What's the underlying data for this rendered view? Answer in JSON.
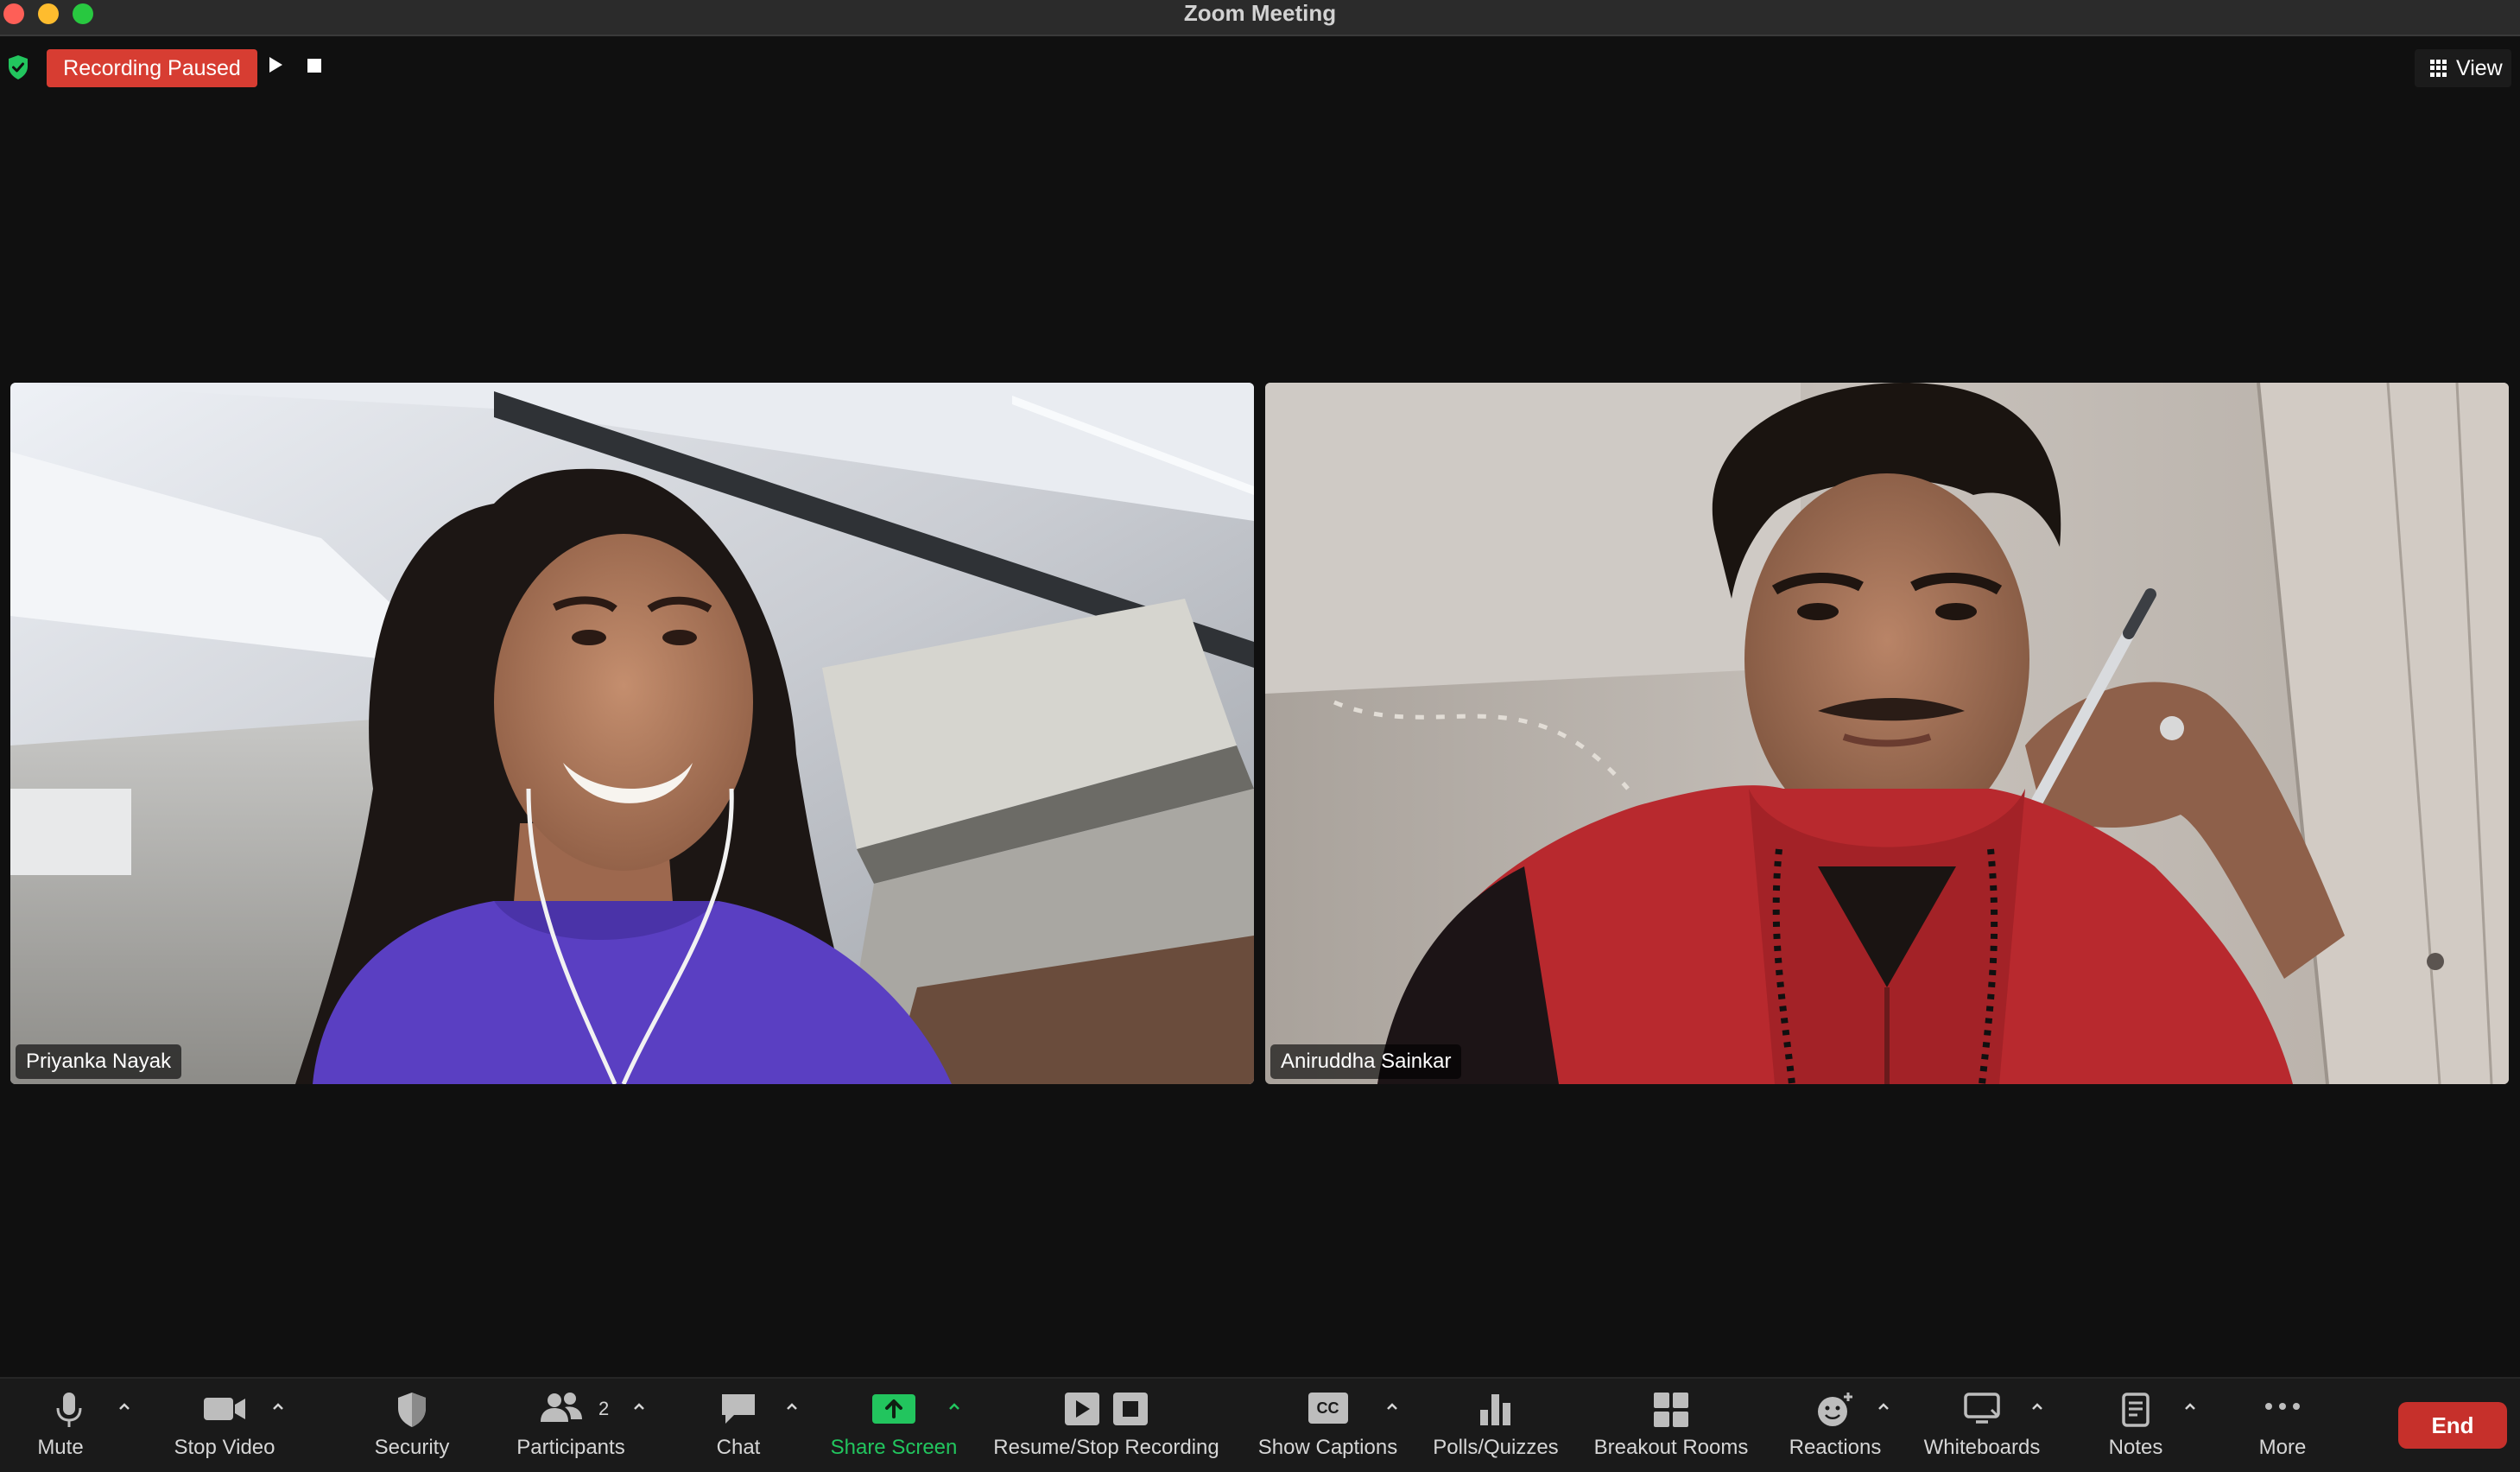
{
  "window": {
    "title": "Zoom Meeting"
  },
  "top_bar": {
    "recording_status": "Recording Paused",
    "view_label": "View"
  },
  "participants": [
    {
      "name": "Priyanka Nayak"
    },
    {
      "name": "Aniruddha Sainkar"
    }
  ],
  "toolbar": {
    "mute": "Mute",
    "stop_video": "Stop Video",
    "security": "Security",
    "participants": "Participants",
    "participant_count": "2",
    "chat": "Chat",
    "share_screen": "Share Screen",
    "recording": "Resume/Stop Recording",
    "captions": "Show Captions",
    "captions_icon_text": "CC",
    "polls": "Polls/Quizzes",
    "breakout": "Breakout Rooms",
    "reactions": "Reactions",
    "whiteboards": "Whiteboards",
    "notes": "Notes",
    "more": "More",
    "end": "End"
  },
  "colors": {
    "background": "#101010",
    "recording_badge": "#d73d32",
    "share_green": "#22c55e",
    "end_button": "#c6302b",
    "security_shield": "#22c55e"
  },
  "icons": [
    "shield-check-icon",
    "play-icon",
    "stop-icon",
    "grid-icon",
    "microphone-icon",
    "camera-icon",
    "shield-icon",
    "people-icon",
    "chat-bubble-icon",
    "share-arrow-icon",
    "cc-icon",
    "bar-chart-icon",
    "breakout-grid-icon",
    "smiley-icon",
    "whiteboard-icon",
    "notes-icon",
    "ellipsis-icon",
    "caret-up-icon"
  ]
}
